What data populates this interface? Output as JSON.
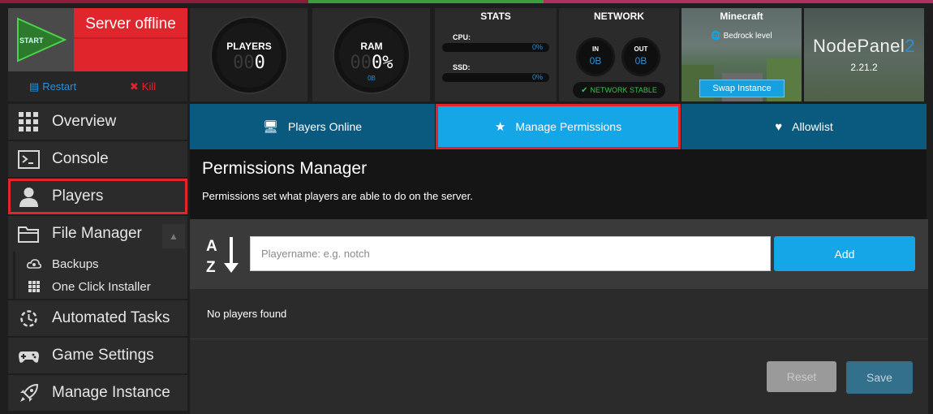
{
  "server": {
    "start_label": "START",
    "status_text": "Server offline",
    "restart_label": "Restart",
    "kill_label": "Kill"
  },
  "gauges": {
    "players": {
      "label": "PLAYERS",
      "dim_digits": "00",
      "value": "0"
    },
    "ram": {
      "label": "RAM",
      "dim_digits": "00",
      "value": "0%",
      "sub": "0B"
    }
  },
  "stats": {
    "title": "STATS",
    "cpu_label": "CPU:",
    "cpu_value": "0%",
    "ssd_label": "SSD:",
    "ssd_value": "0%"
  },
  "network": {
    "title": "NETWORK",
    "in_label": "IN",
    "in_value": "0B",
    "out_label": "OUT",
    "out_value": "0B",
    "stable_text": "NETWORK STABLE"
  },
  "minecraft": {
    "title": "Minecraft",
    "level_text": "Bedrock level",
    "swap_label": "Swap Instance"
  },
  "nodepanel": {
    "name_main": "NodePanel",
    "name_num": "2",
    "version": "2.21.2"
  },
  "sidebar": {
    "items": [
      {
        "label": "Overview",
        "icon": "grid-icon"
      },
      {
        "label": "Console",
        "icon": "terminal-icon"
      },
      {
        "label": "Players",
        "icon": "user-icon"
      },
      {
        "label": "File Manager",
        "icon": "folder-icon"
      },
      {
        "label": "Automated Tasks",
        "icon": "tasks-icon"
      },
      {
        "label": "Game Settings",
        "icon": "gamepad-icon"
      },
      {
        "label": "Manage Instance",
        "icon": "rocket-icon"
      }
    ],
    "subitems": [
      {
        "label": "Backups",
        "icon": "cloud-icon"
      },
      {
        "label": "One Click Installer",
        "icon": "grid-icon"
      }
    ]
  },
  "tabs": [
    {
      "label": "Players Online",
      "icon": "monitor-icon"
    },
    {
      "label": "Manage Permissions",
      "icon": "star-icon"
    },
    {
      "label": "Allowlist",
      "icon": "heart-icon"
    }
  ],
  "main": {
    "title": "Permissions Manager",
    "description": "Permissions set what players are able to do on the server.",
    "input_placeholder": "Playername: e.g. notch",
    "input_value": "",
    "add_label": "Add",
    "empty_text": "No players found",
    "reset_label": "Reset",
    "save_label": "Save"
  },
  "colors": {
    "accent_blue": "#15a6e8",
    "tab_blue": "#0a5a7f",
    "danger_red": "#e1252d",
    "success_green": "#3bbf4a"
  }
}
